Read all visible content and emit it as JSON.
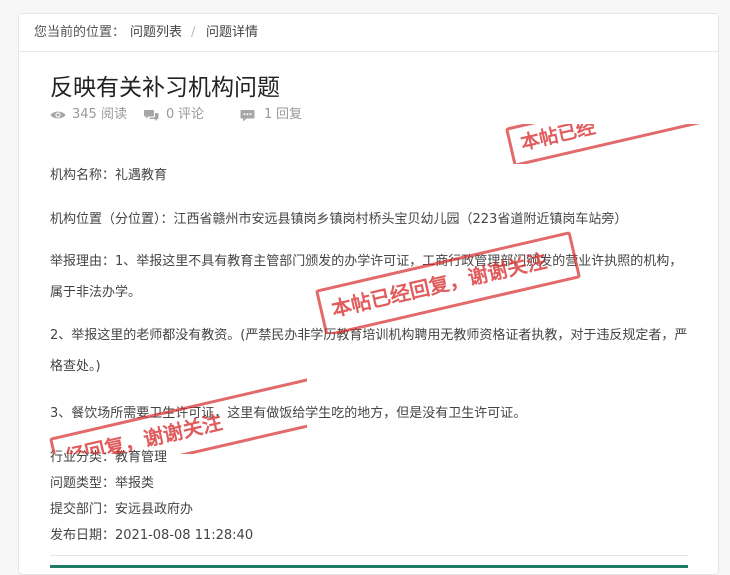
{
  "breadcrumb": {
    "prefix": "您当前的位置：",
    "items": [
      "问题列表",
      "问题详情"
    ],
    "separator": "/"
  },
  "post": {
    "title": "反映有关补习机构问题",
    "stats": {
      "views": "345",
      "views_label": "阅读",
      "comments": "0",
      "comments_label": "评论",
      "replies": "1",
      "replies_label": "回复"
    },
    "paragraphs": [
      "机构名称：礼遇教育",
      "机构位置（分位置）：江西省赣州市安远县镇岗乡镇岗村桥头宝贝幼儿园（223省道附近镇岗车站旁）",
      "举报理由：1、举报这里不具有教育主管部门颁发的办学许可证，工商行政管理部门颁发的营业许执照的机构，属于非法办学。",
      "2、举报这里的老师都没有教资。(严禁民办非学历教育培训机构聘用无教师资格证者执教，对于违反规定者，严格查处。)",
      "3、餐饮场所需要卫生许可证，这里有做饭给学生吃的地方，但是没有卫生许可证。"
    ],
    "fields": [
      {
        "label": "行业分类：",
        "value": "教育管理"
      },
      {
        "label": "问题类型：",
        "value": "举报类"
      },
      {
        "label": "提交部门：",
        "value": "安远县政府办"
      },
      {
        "label": "发布日期：",
        "value": "2021-08-08 11:28:40"
      }
    ]
  },
  "stamps": {
    "main": "本帖已经回复，谢谢关注",
    "top": "本帖已经",
    "bottom": "经回复，谢谢关注"
  },
  "colors": {
    "stamp": "#d83030",
    "bottom_bar": "#1f7a66"
  },
  "icons": {
    "views": "eye-icon",
    "comments": "comment-bubbles-icon",
    "replies": "reply-bubble-icon"
  }
}
